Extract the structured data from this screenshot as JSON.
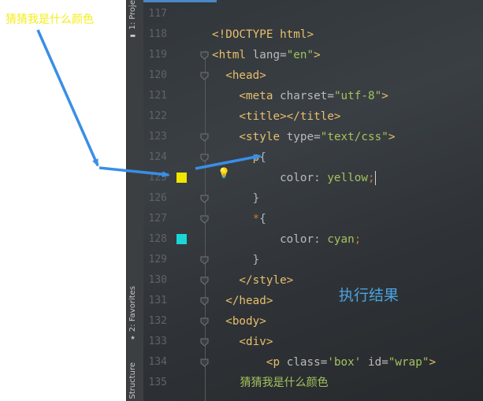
{
  "annotations": {
    "left_caption": "猜猜我是什么颜色",
    "result_caption": "执行结果",
    "arrow_color": "#3a8ee6"
  },
  "tool_windows": [
    {
      "label": "1: Proje",
      "icon": "folder-icon"
    },
    {
      "label": "2: Favorites",
      "icon": "star-icon"
    },
    {
      "label": "Structure",
      "icon": "structure-icon"
    }
  ],
  "editor": {
    "line_numbers": [
      "117",
      "118",
      "119",
      "120",
      "121",
      "122",
      "123",
      "124",
      "125",
      "126",
      "127",
      "128",
      "129",
      "130",
      "131",
      "132",
      "133",
      "134",
      "135"
    ],
    "lines": [
      {
        "tokens": []
      },
      {
        "tokens": [
          {
            "t": "tag",
            "v": "<!DOCTYPE html>"
          }
        ]
      },
      {
        "tokens": [
          {
            "t": "tag",
            "v": "<html "
          },
          {
            "t": "attr",
            "v": "lang="
          },
          {
            "t": "str",
            "v": "\"en\""
          },
          {
            "t": "tag",
            "v": ">"
          }
        ]
      },
      {
        "tokens": [
          {
            "t": "tag",
            "v": "  <head>"
          }
        ]
      },
      {
        "tokens": [
          {
            "t": "tag",
            "v": "    <meta "
          },
          {
            "t": "attr",
            "v": "charset="
          },
          {
            "t": "str",
            "v": "\"utf-8\""
          },
          {
            "t": "tag",
            "v": ">"
          }
        ]
      },
      {
        "tokens": [
          {
            "t": "tag",
            "v": "    <title></title>"
          }
        ]
      },
      {
        "tokens": [
          {
            "t": "tag",
            "v": "    <style "
          },
          {
            "t": "attr",
            "v": "type="
          },
          {
            "t": "str",
            "v": "\"text/css\""
          },
          {
            "t": "tag",
            "v": ">"
          }
        ]
      },
      {
        "tokens": [
          {
            "t": "sel",
            "v": "      p"
          },
          {
            "t": "text_plain",
            "v": "{"
          }
        ]
      },
      {
        "tokens": [
          {
            "t": "prop",
            "v": "          color: "
          },
          {
            "t": "val",
            "v": "yellow"
          },
          {
            "t": "punct",
            "v": ";"
          },
          {
            "t": "caret",
            "v": ""
          }
        ]
      },
      {
        "tokens": [
          {
            "t": "text_plain",
            "v": "      }"
          }
        ]
      },
      {
        "tokens": [
          {
            "t": "star",
            "v": "      *"
          },
          {
            "t": "text_plain",
            "v": "{"
          }
        ]
      },
      {
        "tokens": [
          {
            "t": "prop",
            "v": "          color: "
          },
          {
            "t": "val",
            "v": "cyan"
          },
          {
            "t": "punct",
            "v": ";"
          }
        ]
      },
      {
        "tokens": [
          {
            "t": "text_plain",
            "v": "      }"
          }
        ]
      },
      {
        "tokens": [
          {
            "t": "tag",
            "v": "    </style>"
          }
        ]
      },
      {
        "tokens": [
          {
            "t": "tag",
            "v": "  </head>"
          }
        ]
      },
      {
        "tokens": [
          {
            "t": "tag",
            "v": "  <body>"
          }
        ]
      },
      {
        "tokens": [
          {
            "t": "tag",
            "v": "    <div>"
          }
        ]
      },
      {
        "tokens": [
          {
            "t": "tag",
            "v": "        <p "
          },
          {
            "t": "attr",
            "v": "class="
          },
          {
            "t": "str",
            "v": "'box'"
          },
          {
            "t": "attr",
            "v": " id="
          },
          {
            "t": "str",
            "v": "\"wrap\""
          },
          {
            "t": "tag",
            "v": ">"
          }
        ]
      },
      {
        "tokens": [
          {
            "t": "text",
            "v": "        猜猜我是什么颜色"
          }
        ]
      }
    ],
    "gutter_swatches": [
      {
        "line": "125",
        "color": "#f0e600"
      },
      {
        "line": "128",
        "color": "#1bd6d6"
      }
    ]
  },
  "colors": {
    "accent_tab": "#4a88c7",
    "swatch_yellow": "#f0e600",
    "swatch_cyan": "#1bd6d6"
  }
}
